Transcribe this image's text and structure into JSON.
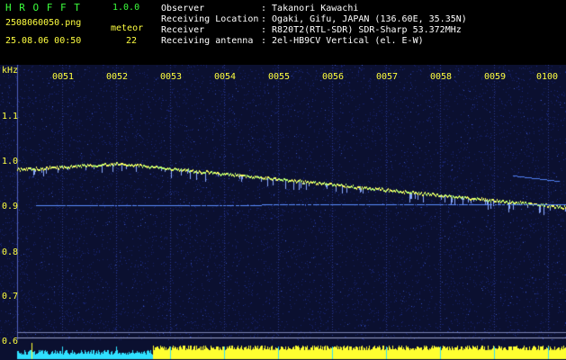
{
  "app": {
    "name": "H R O F F T",
    "version": "1.0.0"
  },
  "file": {
    "name": "2508060050.png",
    "datetime": "25.08.06 00:50"
  },
  "meteor": {
    "label": "meteor",
    "count": "22"
  },
  "info": [
    {
      "key": "Observer",
      "value": ": Takanori Kawachi"
    },
    {
      "key": "Receiving Location",
      "value": ": Ogaki, Gifu, JAPAN (136.60E, 35.35N)"
    },
    {
      "key": "Receiver",
      "value": ": R820T2(RTL-SDR) SDR-Sharp 53.372MHz"
    },
    {
      "key": "Receiving antenna",
      "value": ": 2el-HB9CV Vertical (el. E-W)"
    }
  ],
  "axis": {
    "unit": "kHz",
    "time_ticks": [
      "0051",
      "0052",
      "0053",
      "0054",
      "0055",
      "0056",
      "0057",
      "0058",
      "0059",
      "0100"
    ],
    "freq_ticks": [
      "1.1",
      "1.0",
      "0.9",
      "0.8",
      "0.7",
      "0.6"
    ]
  },
  "colors": {
    "bg": "#0b1030",
    "trace": "#ffff60",
    "cyan": "#30e0ff",
    "yellow": "#ffff30"
  }
}
